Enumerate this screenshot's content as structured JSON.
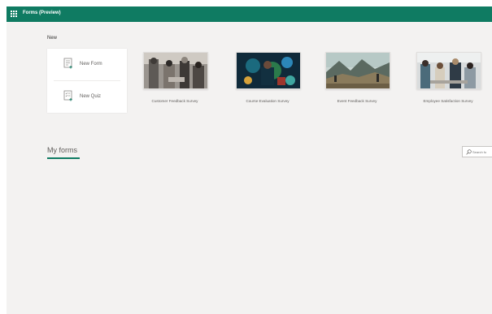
{
  "app": {
    "title": "Forms (Preview)"
  },
  "new_section": {
    "label": "New",
    "new_form_label": "New Form",
    "new_quiz_label": "New Quiz"
  },
  "templates": [
    {
      "label": "Customer Feedback Survey"
    },
    {
      "label": "Course Evaluation Survey"
    },
    {
      "label": "Event Feedback Survey"
    },
    {
      "label": "Employee Satisfaction Survey"
    }
  ],
  "my_forms": {
    "heading": "My forms",
    "search_placeholder": "Search fo"
  },
  "colors": {
    "brand": "#0f7b62",
    "background": "#f3f2f1",
    "text_secondary": "#605e5c"
  }
}
